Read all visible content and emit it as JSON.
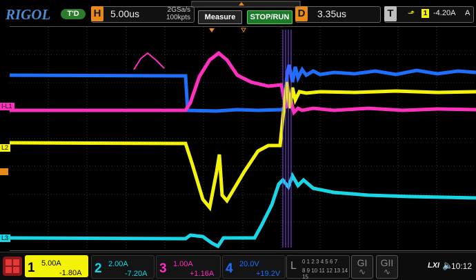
{
  "brand": "RIGOL",
  "trigger_state": "T'D",
  "horizontal": {
    "tag": "H",
    "timebase": "5.00us",
    "sample_rate": "2GSa/s",
    "memory": "100kpts"
  },
  "buttons": {
    "measure": "Measure",
    "stop_run": "STOP/RUN"
  },
  "delay": {
    "tag": "D",
    "value": "3.35us"
  },
  "trigger": {
    "tag": "T",
    "source_num": "1",
    "level": "-4.20A",
    "mode": "A"
  },
  "channel_labels": {
    "i_l1": "I-L1",
    "l2": "L2",
    "l3": "L3"
  },
  "channels": [
    {
      "num": "1",
      "scale": "5.00A",
      "offset": "-1.80A",
      "color": "#f5f20a"
    },
    {
      "num": "2",
      "scale": "2.00A",
      "offset": "-7.20A",
      "color": "#19d6e6"
    },
    {
      "num": "3",
      "scale": "1.00A",
      "offset": "+1.16A",
      "color": "#ff2fbf"
    },
    {
      "num": "4",
      "scale": "20.0V",
      "offset": "+19.2V",
      "color": "#1f6fff"
    }
  ],
  "logic": {
    "tag": "L",
    "row1": "0 1 2 3 4 5 6 7",
    "row2": "8 9 10 11 12 13 14 15"
  },
  "generators": [
    "GI",
    "GII"
  ],
  "status": {
    "lxi": "LXI",
    "time": "10:12"
  },
  "colors": {
    "trigger_orange": "#e88a1a",
    "stop_run_green": "#1d7a2a"
  }
}
